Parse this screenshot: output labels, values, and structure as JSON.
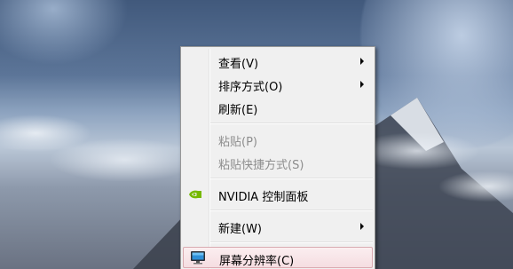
{
  "context_menu": {
    "items": [
      {
        "label": "查看(V)",
        "has_submenu": true,
        "enabled": true
      },
      {
        "label": "排序方式(O)",
        "has_submenu": true,
        "enabled": true
      },
      {
        "label": "刷新(E)",
        "has_submenu": false,
        "enabled": true
      },
      {
        "label": "粘贴(P)",
        "has_submenu": false,
        "enabled": false
      },
      {
        "label": "粘贴快捷方式(S)",
        "has_submenu": false,
        "enabled": false
      },
      {
        "label": "NVIDIA 控制面板",
        "has_submenu": false,
        "enabled": true,
        "icon": "nvidia-icon"
      },
      {
        "label": "新建(W)",
        "has_submenu": true,
        "enabled": true
      },
      {
        "label": "屏幕分辨率(C)",
        "has_submenu": false,
        "enabled": true,
        "icon": "monitor-icon",
        "highlighted": true
      }
    ]
  },
  "colors": {
    "menu_background": "#f0f0f0",
    "disabled_text": "#8d8d8d",
    "highlight_border": "#d9aab0",
    "nvidia_green": "#76b900"
  }
}
